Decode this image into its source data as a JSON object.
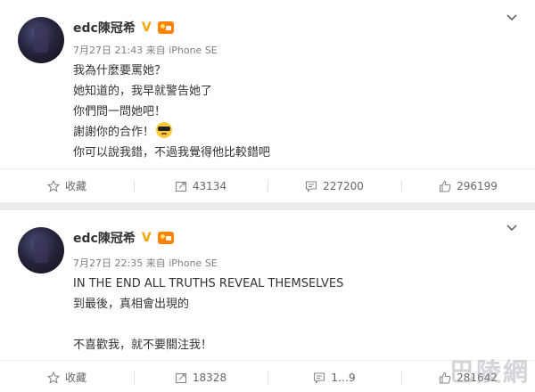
{
  "posts": [
    {
      "username": "edc陳冠希",
      "verified_mark": "V",
      "level_icon": "vip-level-icon",
      "time": "7月27日 21:43",
      "source": "来自 iPhone SE",
      "lines": [
        "我為什麼要罵她？",
        "她知道的，我早就警告她了",
        "你們問一問她吧！",
        "謝謝你的合作！",
        "你可以說我錯，不過我覺得他比較錯吧"
      ],
      "emoji": "sunglasses-emoji",
      "actions": {
        "favorite": "收藏",
        "repost": "43134",
        "comment": "227200",
        "like": "296199"
      }
    },
    {
      "username": "edc陳冠希",
      "verified_mark": "V",
      "level_icon": "vip-level-icon",
      "time": "7月27日 22:35",
      "source": "来自 iPhone SE",
      "lines": [
        "IN THE END ALL TRUTHS REVEAL THEMSELVES",
        "到最後，真相會出現的",
        "",
        "不喜歡我，就不要關注我！"
      ],
      "actions": {
        "favorite": "收藏",
        "repost": "18328",
        "comment": "1…9",
        "like": "281642"
      }
    }
  ],
  "watermark": "巴陵網",
  "colors": {
    "verified": "#f7a600",
    "level": "#ff8200",
    "text": "#333333",
    "meta": "#808080",
    "background": "#e9ebee"
  }
}
